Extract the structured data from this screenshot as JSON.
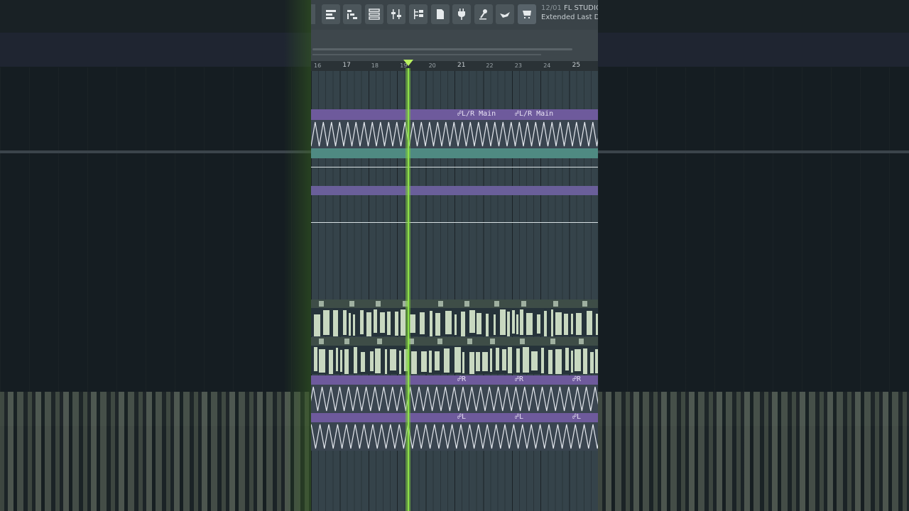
{
  "hint_bar": {
    "time": "12/01",
    "title": "FL STUDIO",
    "subtitle": "Extended Last Da"
  },
  "toolbar": {
    "buttons": [
      {
        "name": "playlist-icon"
      },
      {
        "name": "piano-roll-icon"
      },
      {
        "name": "channel-rack-icon"
      },
      {
        "name": "mixer-icon"
      },
      {
        "name": "browser-tree-icon"
      },
      {
        "name": "project-file-icon"
      },
      {
        "name": "plugin-plug-icon"
      },
      {
        "name": "microphone-icon"
      },
      {
        "name": "hand-help-icon"
      },
      {
        "name": "shop-cart-icon"
      }
    ]
  },
  "ruler": {
    "bars": [
      "16",
      "17",
      "18",
      "19",
      "20",
      "21",
      "22",
      "23",
      "24",
      "25"
    ]
  },
  "playhead": {
    "bar": 19.2
  },
  "clips": {
    "lr_main_label": "L/R Main",
    "r_label": "R",
    "l_label": "L"
  },
  "colors": {
    "automation_clip": "#6e5a9c",
    "playhead": "#8fe04a",
    "teal_pattern": "#4f8a82",
    "audio_wave": "#c8d8c0"
  }
}
